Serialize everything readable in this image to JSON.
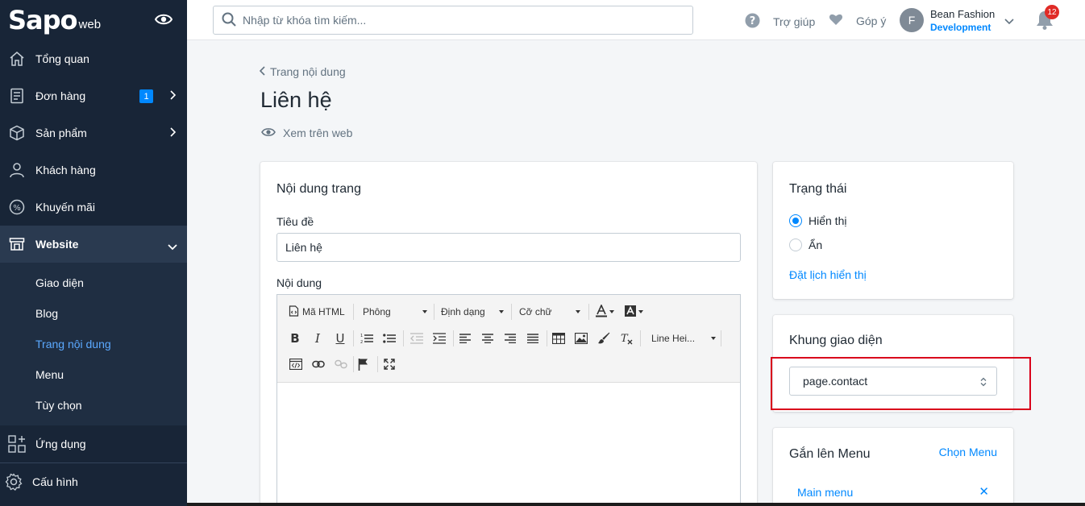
{
  "brand": {
    "logo": "Sapo",
    "logo_sub": "web"
  },
  "sidebar": {
    "items": [
      {
        "label": "Tổng quan",
        "icon": "home-icon"
      },
      {
        "label": "Đơn hàng",
        "icon": "order-icon",
        "badge": "1"
      },
      {
        "label": "Sản phẩm",
        "icon": "box-icon"
      },
      {
        "label": "Khách hàng",
        "icon": "user-icon"
      },
      {
        "label": "Khuyến mãi",
        "icon": "percent-icon"
      },
      {
        "label": "Website",
        "icon": "store-icon"
      }
    ],
    "website_sub": [
      "Giao diện",
      "Blog",
      "Trang nội dung",
      "Menu",
      "Tùy chọn"
    ],
    "apps": "Ứng dụng",
    "settings": "Cấu hình"
  },
  "topbar": {
    "search_placeholder": "Nhập từ khóa tìm kiếm...",
    "help": "Trợ giúp",
    "feedback": "Góp ý",
    "avatar_letter": "F",
    "store_name": "Bean Fashion",
    "store_env": "Development",
    "notifications": "12"
  },
  "page": {
    "breadcrumb": "Trang nội dung",
    "title": "Liên hệ",
    "view_on_web": "Xem trên web"
  },
  "content_card": {
    "title": "Nội dung trang",
    "title_label": "Tiêu đề",
    "title_value": "Liên hệ",
    "content_label": "Nội dung",
    "toolbar": {
      "html": "Mã HTML",
      "font": "Phông",
      "format": "Định dạng",
      "size": "Cỡ chữ",
      "line_height": "Line Hei..."
    }
  },
  "status_card": {
    "title": "Trạng thái",
    "visible": "Hiển thị",
    "hidden": "Ẩn",
    "schedule": "Đặt lịch hiển thị"
  },
  "template_card": {
    "title": "Khung giao diện",
    "selected": "page.contact"
  },
  "menu_card": {
    "title": "Gắn lên Menu",
    "choose": "Chọn Menu",
    "item": "Main menu",
    "remove_symbol": "✕"
  },
  "colors": {
    "sidebar_bg": "#182537",
    "accent": "#0088ff",
    "highlight": "#d9001b"
  }
}
